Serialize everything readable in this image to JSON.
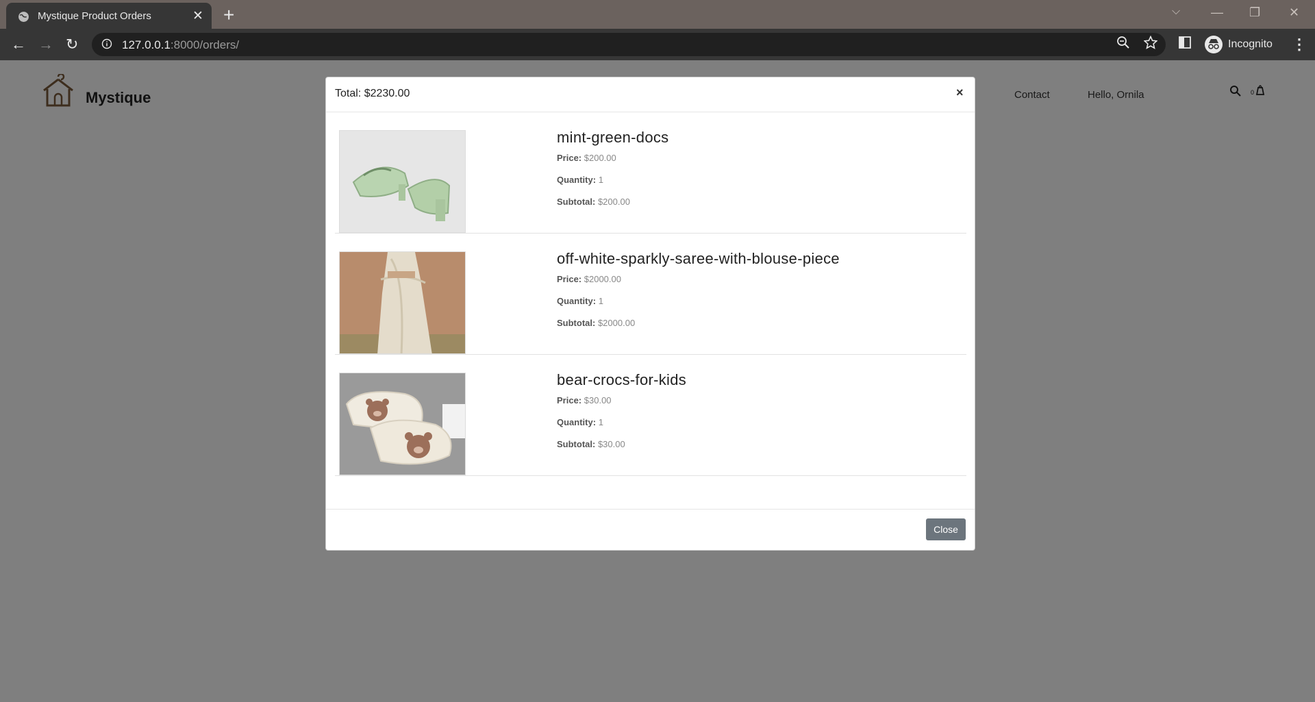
{
  "browser": {
    "tab_title": "Mystique Product Orders",
    "url_host": "127.0.0.1",
    "url_path": ":8000/orders/",
    "incognito_label": "Incognito"
  },
  "site": {
    "brand": "Mystique",
    "nav": [
      "Contact",
      "Hello, Ornila"
    ],
    "cart_count": "0"
  },
  "modal": {
    "title": "Total: $2230.00",
    "close_x": "×",
    "close_label": "Close",
    "price_label": "Price:",
    "quantity_label": "Quantity:",
    "subtotal_label": "Subtotal:",
    "items": [
      {
        "name": "mint-green-docs",
        "price": "$200.00",
        "quantity": "1",
        "subtotal": "$200.00"
      },
      {
        "name": "off-white-sparkly-saree-with-blouse-piece",
        "price": "$2000.00",
        "quantity": "1",
        "subtotal": "$2000.00"
      },
      {
        "name": "bear-crocs-for-kids",
        "price": "$30.00",
        "quantity": "1",
        "subtotal": "$30.00"
      }
    ]
  }
}
